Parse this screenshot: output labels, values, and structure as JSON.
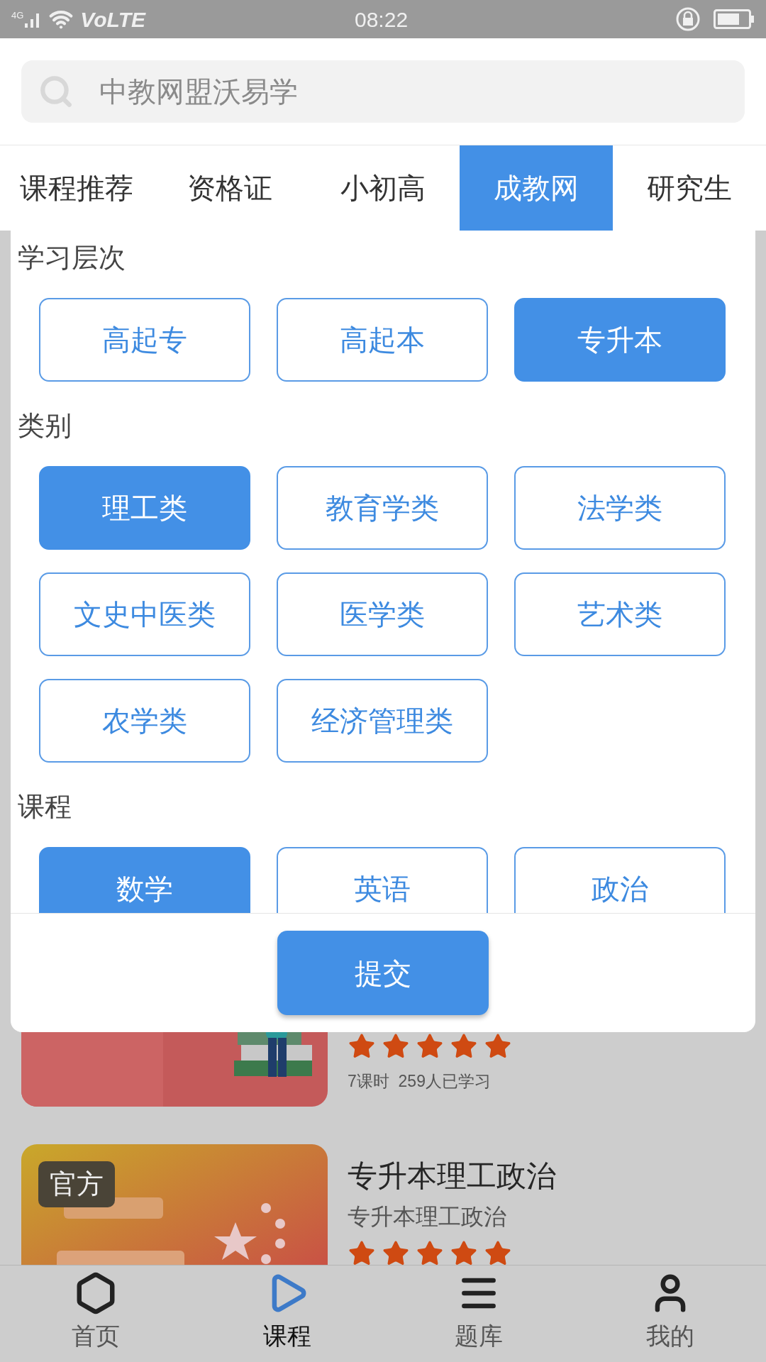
{
  "status_bar": {
    "network": "4G",
    "carrier": "VoLTE",
    "time": "08:22"
  },
  "search": {
    "placeholder": "中教网盟沃易学"
  },
  "tabs": [
    {
      "label": "课程推荐",
      "selected": false
    },
    {
      "label": "资格证",
      "selected": false
    },
    {
      "label": "小初高",
      "selected": false
    },
    {
      "label": "成教网",
      "selected": true
    },
    {
      "label": "研究生",
      "selected": false
    }
  ],
  "filter_panel": {
    "sections": [
      {
        "title": "学习层次",
        "options": [
          {
            "label": "高起专",
            "selected": false
          },
          {
            "label": "高起本",
            "selected": false
          },
          {
            "label": "专升本",
            "selected": true
          }
        ]
      },
      {
        "title": "类别",
        "options": [
          {
            "label": "理工类",
            "selected": true
          },
          {
            "label": "教育学类",
            "selected": false
          },
          {
            "label": "法学类",
            "selected": false
          },
          {
            "label": "文史中医类",
            "selected": false
          },
          {
            "label": "医学类",
            "selected": false
          },
          {
            "label": "艺术类",
            "selected": false
          },
          {
            "label": "农学类",
            "selected": false
          },
          {
            "label": "经济管理类",
            "selected": false
          }
        ]
      },
      {
        "title": "课程",
        "options": [
          {
            "label": "数学",
            "selected": true
          },
          {
            "label": "英语",
            "selected": false
          },
          {
            "label": "政治",
            "selected": false
          }
        ]
      }
    ],
    "submit": "提交"
  },
  "courses": [
    {
      "kind": "picture",
      "stars": 5,
      "meta": "7课时  259人已学习"
    },
    {
      "kind": "picture",
      "badge": "官方",
      "title": "专升本理工政治",
      "subtitle": "专升本理工政治",
      "stars": 5
    }
  ],
  "bottom_nav": [
    {
      "label": "首页",
      "selected": false
    },
    {
      "label": "课程",
      "selected": true
    },
    {
      "label": "题库",
      "selected": false
    },
    {
      "label": "我的",
      "selected": false
    }
  ]
}
